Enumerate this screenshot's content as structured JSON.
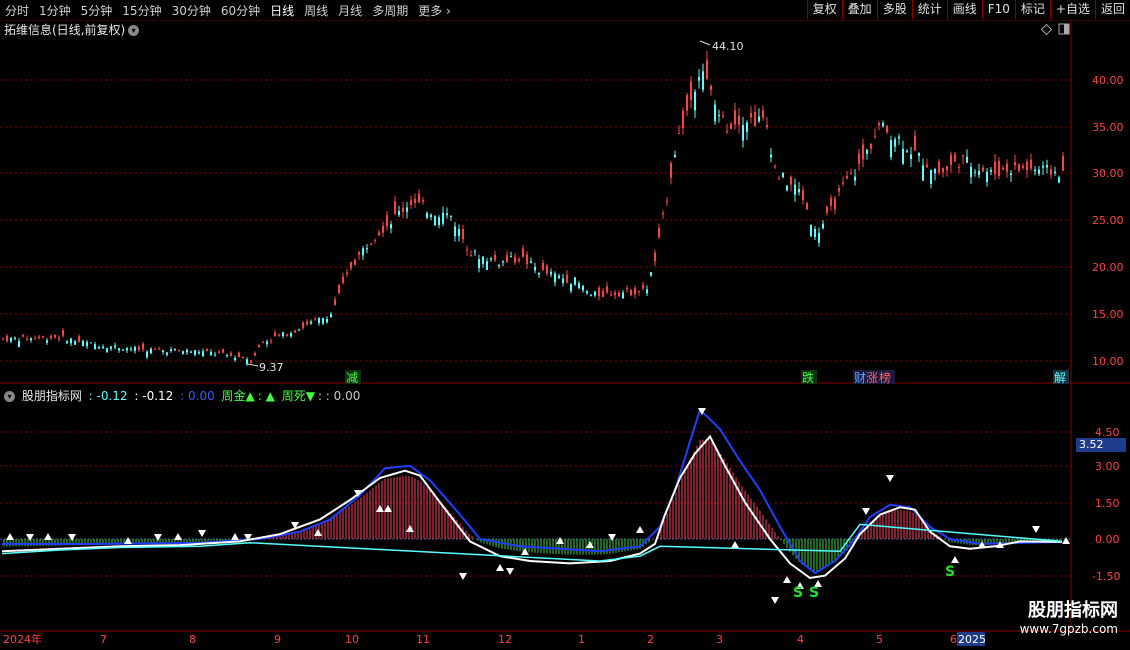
{
  "toolbar": {
    "periods": [
      "分时",
      "1分钟",
      "5分钟",
      "15分钟",
      "30分钟",
      "60分钟",
      "日线",
      "周线",
      "月线",
      "多周期",
      "更多"
    ],
    "active_period": "日线",
    "right_buttons": [
      "复权",
      "叠加",
      "多股",
      "统计",
      "画线",
      "F10",
      "标记",
      "+自选",
      "返回"
    ]
  },
  "main_panel": {
    "title": "拓维信息(日线,前复权)",
    "high_label": "44.10",
    "low_label": "9.37",
    "price_ticks": [
      "40.00",
      "35.00",
      "30.00",
      "25.00",
      "20.00",
      "15.00",
      "10.00"
    ],
    "event_markers": [
      "减",
      "跌",
      "财",
      "涨",
      "榜",
      "解"
    ]
  },
  "indicator_panel": {
    "name": "股朋指标网",
    "v1": ": -0.12",
    "v2": ": -0.12",
    "v3": ": 0.00",
    "zhoujin_label": "周金▲",
    "zhoujin_val": ": ▲",
    "zhousi_label": "周死▼",
    "zhousi_val": ": : 0.00",
    "ticks": [
      "4.50",
      "3.00",
      "1.50",
      "0.00",
      "-1.50"
    ],
    "current_badge": "3.52",
    "s_marks": [
      "S",
      "S",
      "S"
    ]
  },
  "time_axis": {
    "labels": [
      "2024年",
      "7",
      "8",
      "9",
      "10",
      "11",
      "12",
      "1",
      "2",
      "3",
      "4",
      "5",
      "6",
      "2025"
    ]
  },
  "watermark": {
    "title": "股朋指标网",
    "url": "www.7gpzb.com"
  },
  "colors": {
    "up": "#ff4040",
    "down": "#54ffff",
    "dif_line": "#ffffff",
    "dea_line": "#1f3fff",
    "grid": "#8a0000"
  }
}
